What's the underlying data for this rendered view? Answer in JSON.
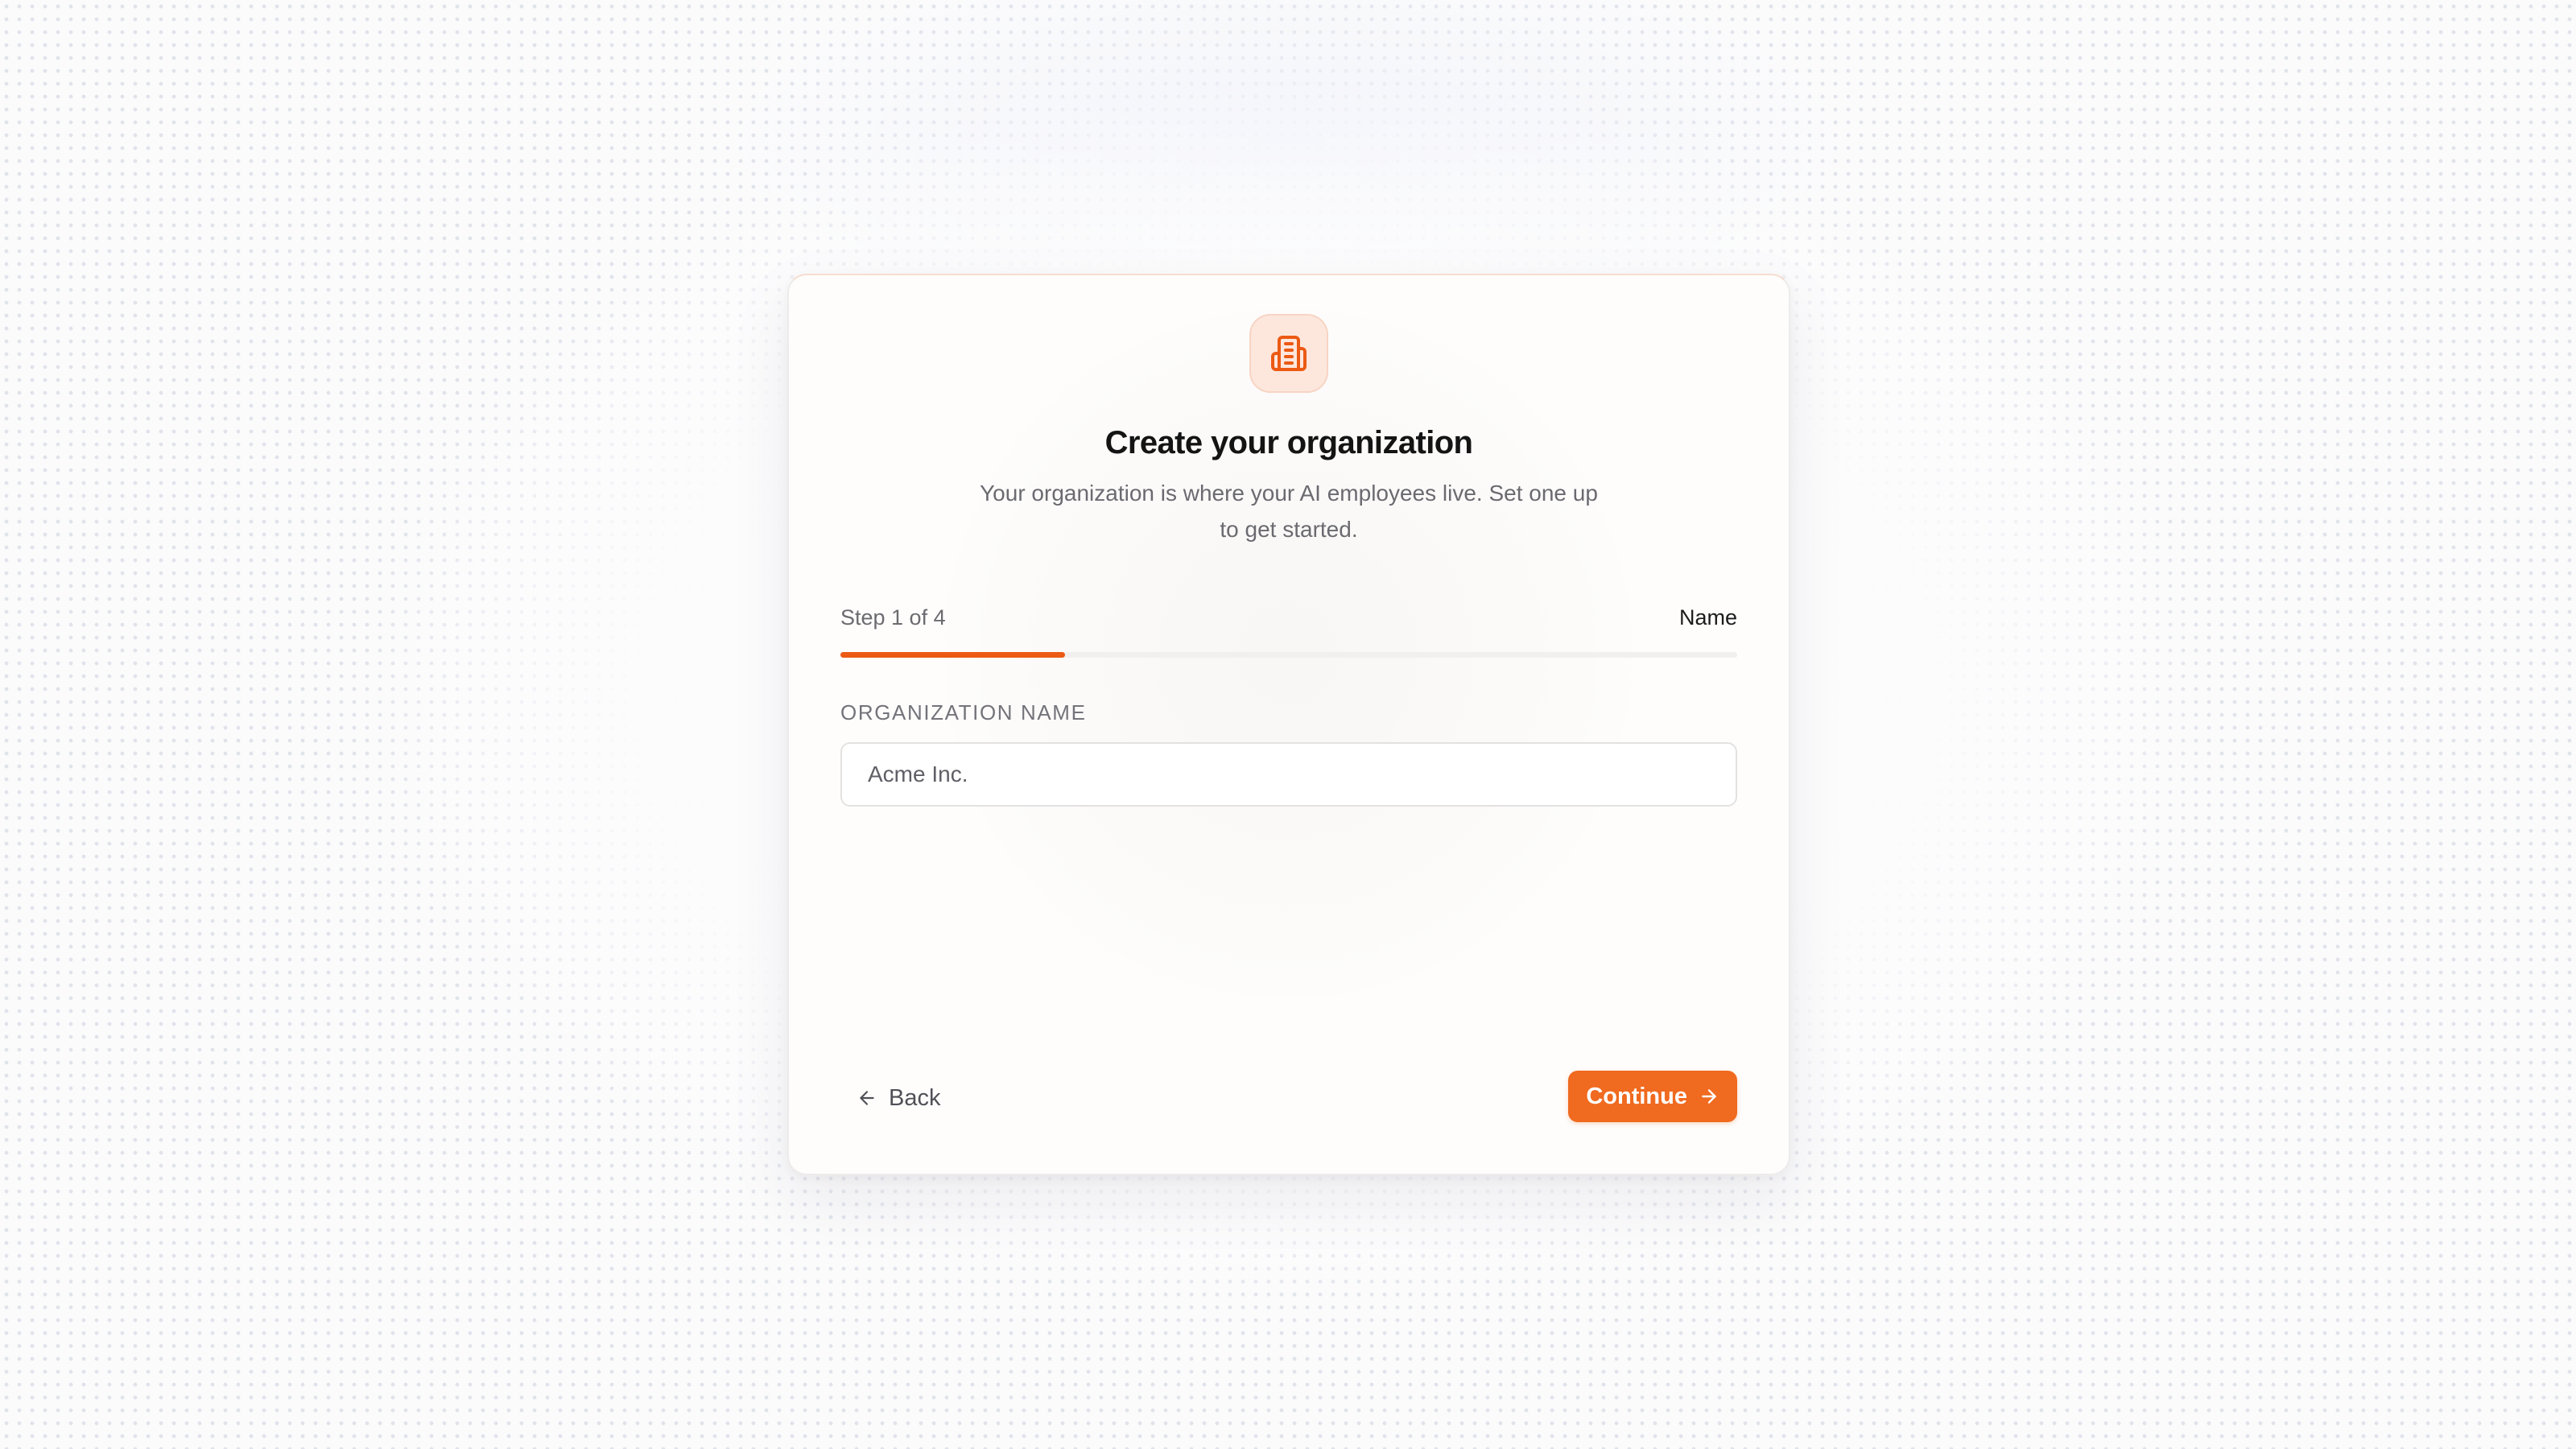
{
  "theme": {
    "accent": "#ec5a14",
    "button_bg": "#f06a1f",
    "icon_bg": "#fde7dd"
  },
  "header": {
    "icon": "building-icon",
    "title": "Create your organization",
    "subtitle": "Your organization is where your AI employees live. Set one up to get started."
  },
  "progress": {
    "step_label": "Step 1 of 4",
    "step_name": "Name",
    "current_step": 1,
    "total_steps": 4,
    "fraction": 0.25
  },
  "form": {
    "org_name_label": "ORGANIZATION NAME",
    "org_name_placeholder": "Acme Inc.",
    "org_name_value": ""
  },
  "actions": {
    "back_label": "Back",
    "back_icon": "arrow-left-icon",
    "continue_label": "Continue",
    "continue_icon": "arrow-right-icon"
  }
}
